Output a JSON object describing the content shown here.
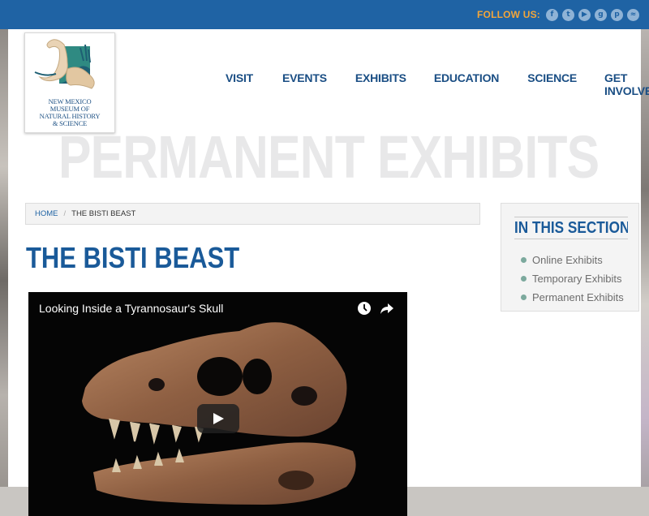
{
  "header": {
    "follow_label": "FOLLOW US:",
    "social": [
      {
        "icon": "facebook-icon",
        "glyph": "f"
      },
      {
        "icon": "twitter-icon",
        "glyph": "t"
      },
      {
        "icon": "youtube-icon",
        "glyph": "▶"
      },
      {
        "icon": "google-plus-icon",
        "glyph": "g"
      },
      {
        "icon": "pinterest-icon",
        "glyph": "p"
      },
      {
        "icon": "rss-icon",
        "glyph": "≈"
      }
    ]
  },
  "logo": {
    "lines": [
      "NEW MEXICO",
      "MUSEUM OF",
      "NATURAL HISTORY",
      "& SCIENCE"
    ]
  },
  "nav": {
    "items": [
      "VISIT",
      "EVENTS",
      "EXHIBITS",
      "EDUCATION",
      "SCIENCE",
      "GET INVOLVED"
    ]
  },
  "hero": {
    "title": "PERMANENT EXHIBITS"
  },
  "breadcrumb": {
    "home": "HOME",
    "separator": "/",
    "current": "THE BISTI BEAST"
  },
  "page": {
    "title": "THE BISTI BEAST"
  },
  "video": {
    "title": "Looking Inside a Tyrannosaur's Skull",
    "icons": [
      "clock-icon",
      "share-icon",
      "play-icon"
    ]
  },
  "sidebar": {
    "heading": "IN THIS SECTION",
    "items": [
      "Online Exhibits",
      "Temporary Exhibits",
      "Permanent Exhibits"
    ]
  },
  "colors": {
    "topbar": "#1f63a4",
    "accent_orange": "#f3a63a",
    "heading_blue": "#1a5a99",
    "bullet_teal": "#7ca99d"
  }
}
